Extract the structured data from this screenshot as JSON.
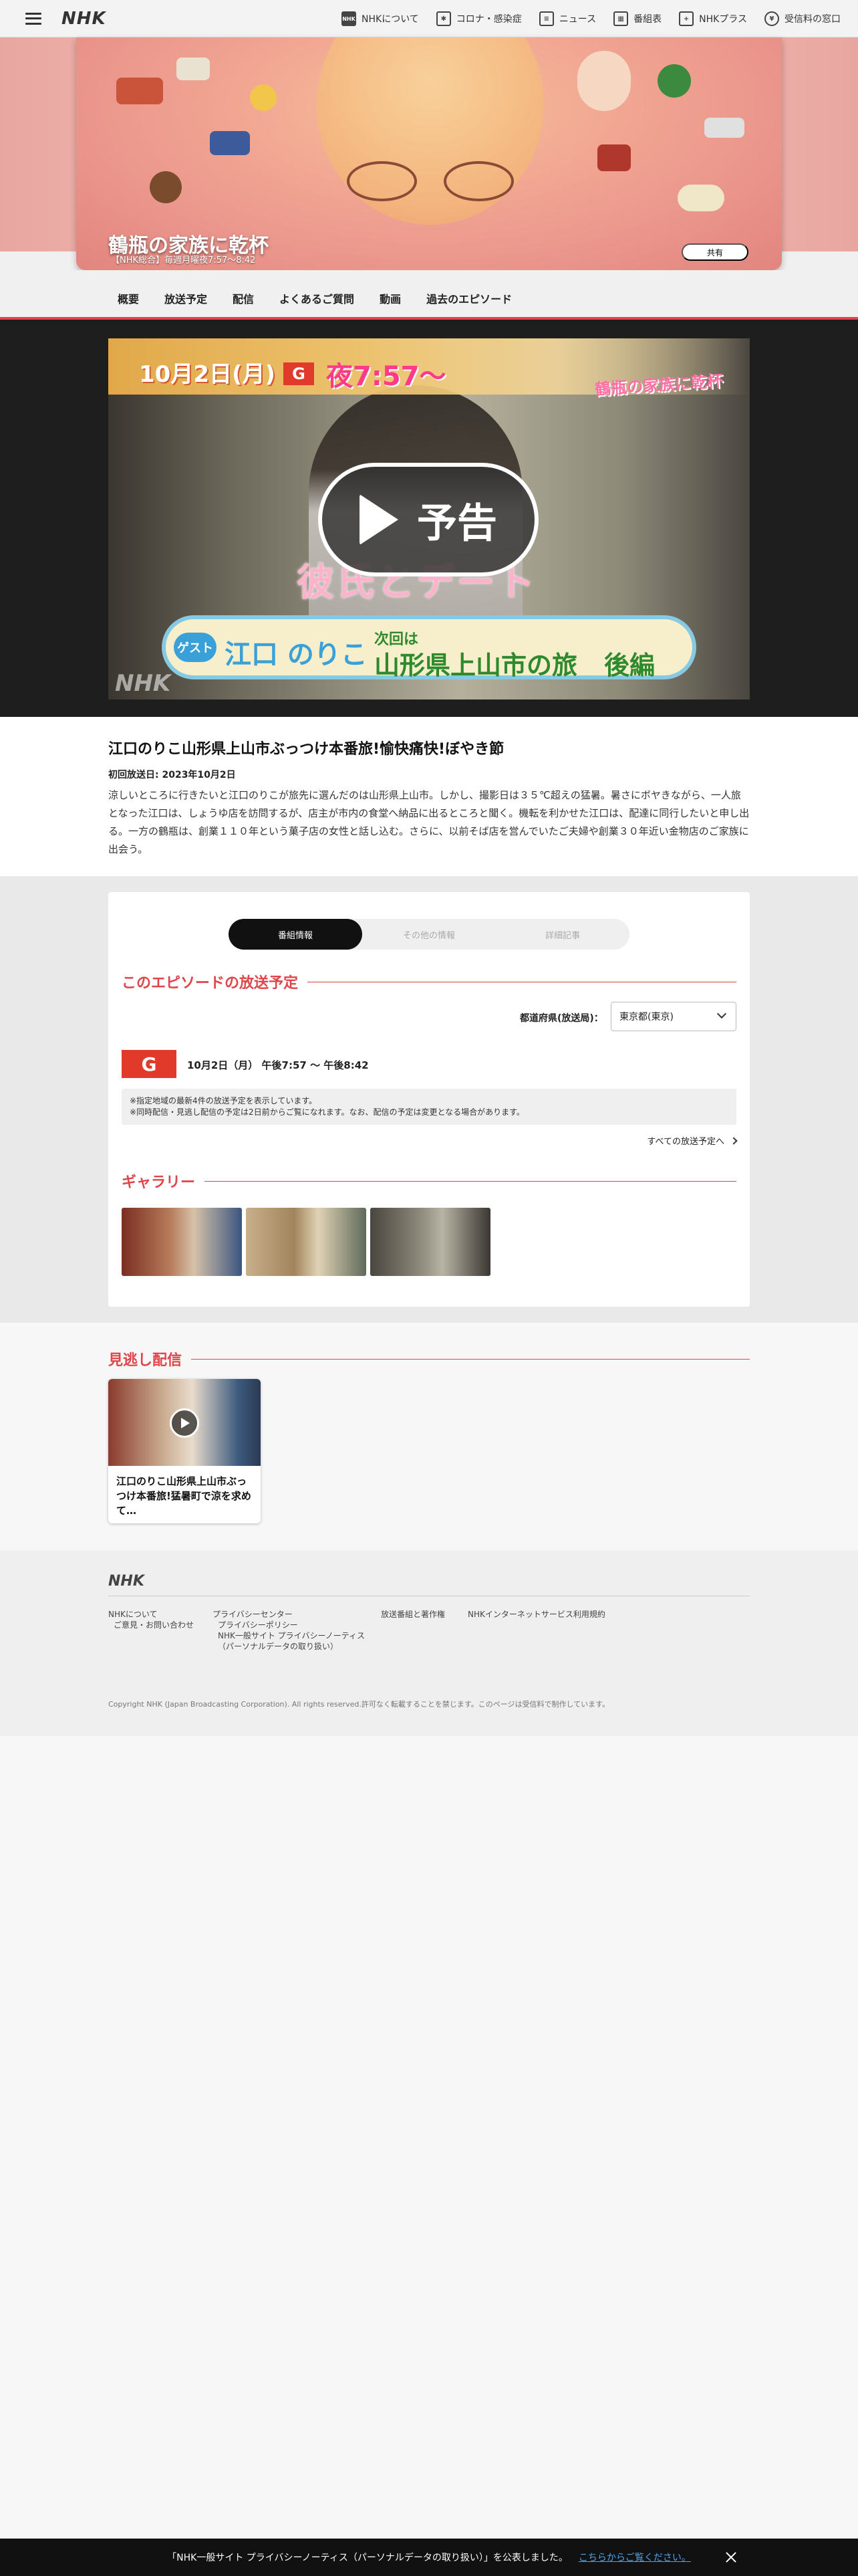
{
  "header": {
    "logo": "NHK",
    "nav": [
      {
        "label": "NHKについて",
        "icon": "nhk-icon"
      },
      {
        "label": "コロナ・感染症",
        "icon": "virus-icon"
      },
      {
        "label": "ニュース",
        "icon": "news-icon"
      },
      {
        "label": "番組表",
        "icon": "schedule-icon"
      },
      {
        "label": "NHKプラス",
        "icon": "nhk-plus-icon"
      },
      {
        "label": "受信料の窓口",
        "icon": "tv-icon"
      }
    ]
  },
  "hero": {
    "title": "鶴瓶の家族に乾杯",
    "subtitle": "【NHK総合】毎週月曜夜7:57〜8:42",
    "share_label": "共有"
  },
  "subnav": [
    "概要",
    "放送予定",
    "配信",
    "よくあるご質問",
    "動画",
    "過去のエピソード"
  ],
  "video": {
    "play_label": "予告",
    "overlay": {
      "date": "10月2日(月)",
      "channel": "G",
      "time": "夜7:57〜",
      "show_logo": "鶴瓶の家族に乾杯",
      "headline": "彼氏とデート",
      "guest_tag": "ゲスト",
      "guest_name": "江口 のりこ",
      "next_label": "次回は",
      "place": "山形県上山市の旅",
      "part": "後編",
      "watermark": "NHK"
    }
  },
  "episode": {
    "title": "江口のりこ山形県上山市ぶっつけ本番旅!愉快痛快!ぼやき節",
    "first_broadcast": "初回放送日: 2023年10月2日",
    "description": "涼しいところに行きたいと江口のりこが旅先に選んだのは山形県上山市。しかし、撮影日は３５℃超えの猛暑。暑さにボヤきながら、一人旅となった江口は、しょうゆ店を訪問するが、店主が市内の食堂へ納品に出るところと聞く。機転を利かせた江口は、配達に同行したいと申し出る。一方の鶴瓶は、創業１１０年という菓子店の女性と話し込む。さらに、以前そば店を営んでいたご夫婦や創業３０年近い金物店のご家族に出会う。"
  },
  "info": {
    "tabs": [
      {
        "label": "番組情報",
        "active": true
      },
      {
        "label": "その他の情報",
        "active": false
      },
      {
        "label": "詳細記事",
        "active": false
      }
    ],
    "broadcast_heading": "このエピソードの放送予定",
    "region_label": "都道府県(放送局)：",
    "region_value": "東京都(東京)",
    "channel_badge": "G",
    "schedule": "10月2日（月） 午後7:57 〜 午後8:42",
    "notes": [
      "※指定地域の最新4件の放送予定を表示しています。",
      "※同時配信・見逃し配信の予定は2日前からご覧になれます。なお、配信の予定は変更となる場合があります。"
    ],
    "all_schedule_link": "すべての放送予定へ",
    "gallery_heading": "ギャラリー",
    "gallery_colors": [
      "#8c4a3a",
      "#b49a78",
      "#6f6a62"
    ]
  },
  "catchup": {
    "heading": "見逃し配信",
    "card_title": "江口のりこ山形県上山市ぶっつけ本番旅!猛暑町で涼を求めて…"
  },
  "footer": {
    "logo": "NHK",
    "links": {
      "about": "NHKについて",
      "contact": "ご意見・お問い合わせ",
      "privacy_center": "プライバシーセンター",
      "privacy_policy": "プライバシーポリシー",
      "privacy_notice_1": "NHK一般サイト プライバシーノーティス",
      "privacy_notice_2": "（パーソナルデータの取り扱い）",
      "copyright_rules": "放送番組と著作権",
      "terms": "NHKインターネットサービス利用規約"
    },
    "copyright": "Copyright NHK (Japan Broadcasting Corporation). All rights reserved.許可なく転載することを禁じます。このページは受信料で制作しています。"
  },
  "privacy_bar": {
    "text": "「NHK一般サイト プライバシーノーティス（パーソナルデータの取り扱い）」を公表しました。",
    "link": "こちらからご覧ください。"
  },
  "colors": {
    "accent": "#e0454a",
    "channel_g": "#e23a2a",
    "link": "#4fa3e8"
  }
}
